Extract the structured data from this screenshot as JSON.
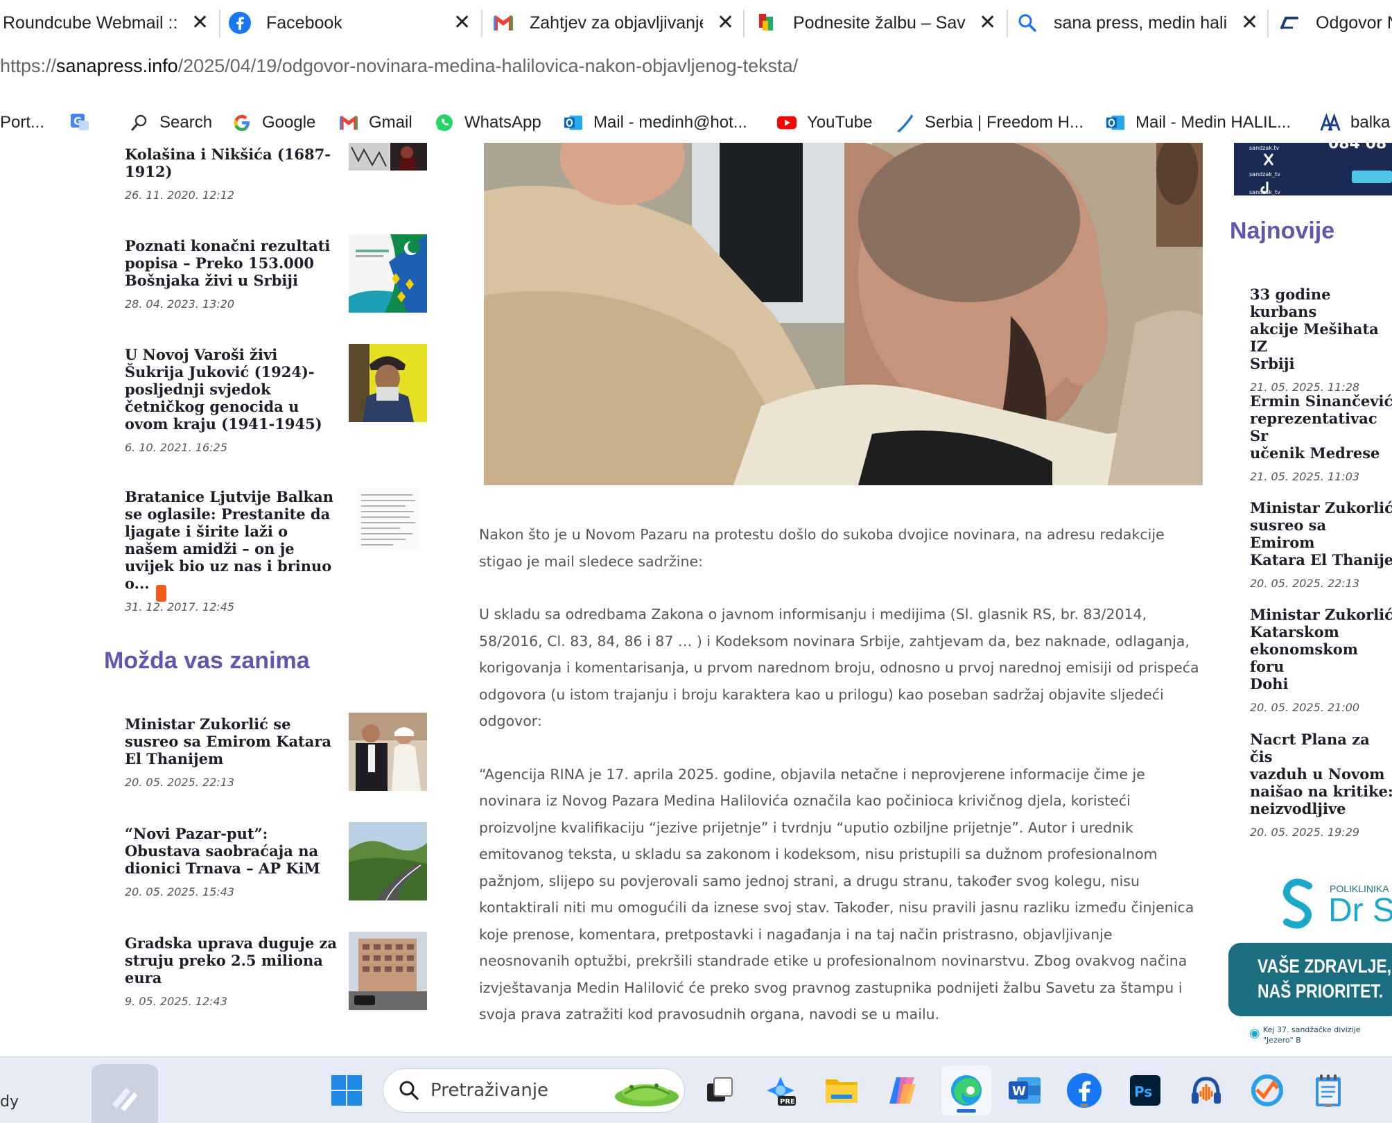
{
  "browser": {
    "tabs": [
      {
        "title": "Roundcube Webmail :: I",
        "icon": "roundcube-icon"
      },
      {
        "title": "Facebook",
        "icon": "facebook-icon"
      },
      {
        "title": "Zahtjev za objavljivanje",
        "icon": "gmail-icon"
      },
      {
        "title": "Podnesite žalbu – Savet",
        "icon": "savet-icon"
      },
      {
        "title": "sana press, medin halilo",
        "icon": "search-icon"
      },
      {
        "title": "Odgovor N",
        "icon": "sanapress-icon"
      }
    ],
    "url": {
      "prefix": "https://",
      "host": "sanapress.info",
      "path": "/2025/04/19/odgovor-novinara-medina-halilovica-nakon-objavljenog-teksta/"
    },
    "bookmarks": [
      {
        "label": "Port...",
        "icon": ""
      },
      {
        "label": "",
        "icon": "translate-icon"
      },
      {
        "label": "Search",
        "icon": "search-icon"
      },
      {
        "label": "Google",
        "icon": "google-icon"
      },
      {
        "label": "Gmail",
        "icon": "gmail-icon"
      },
      {
        "label": "WhatsApp",
        "icon": "whatsapp-icon"
      },
      {
        "label": "Mail - medinh@hot...",
        "icon": "outlook-icon"
      },
      {
        "label": "YouTube",
        "icon": "youtube-icon"
      },
      {
        "label": "Serbia | Freedom H...",
        "icon": "freedom-house-icon"
      },
      {
        "label": "Mail - Medin HALIL...",
        "icon": "outlook-icon"
      },
      {
        "label": "balka",
        "icon": "aa-icon"
      }
    ]
  },
  "left_sidebar": {
    "top_items": [
      {
        "title": "Kolašina i Nikšića (1687-1912)",
        "date": "26. 11. 2020. 12:12"
      },
      {
        "title": "Poznati konačni rezultati popisa – Preko 153.000 Bošnjaka živi u Srbiji",
        "date": "28. 04. 2023. 13:20"
      },
      {
        "title": "U Novoj Varoši živi Šukrija Juković (1924)- posljednji svjedok četničkog genocida u ovom kraju (1941-1945)",
        "date": "6. 10. 2021. 16:25"
      },
      {
        "title": "Bratanice Ljutvije Balkan se oglasile: Prestanite da ljagate i širite laži o našem amidži – on je uvijek bio uz nas i brinuo o...",
        "date": "31. 12. 2017. 12:45"
      }
    ],
    "heading": "Možda vas zanima",
    "more_items": [
      {
        "title": "Ministar Zukorlić se susreo sa Emirom Katara El Thanijem",
        "date": "20. 05. 2025. 22:13"
      },
      {
        "title": "“Novi Pazar-put”: Obustava saobraćaja na dionici Trnava – AP KiM",
        "date": "20. 05. 2025. 15:43"
      },
      {
        "title": "Gradska uprava duguje za struju preko 2.5 miliona eura",
        "date": "9. 05. 2025. 12:43"
      }
    ]
  },
  "article": {
    "paragraphs": [
      "Nakon što je u Novom Pazaru na protestu došlo do sukoba dvojice novinara, na adresu redakcije stigao je mail sledece sadržine:",
      "U skladu sa odredbama Zakona o javnom informisanju i medijima (Sl. glasnik RS, br. 83/2014, 58/2016, Cl. 83, 84, 86 i 87 … ) i Kodeksom novinara Srbije, zahtjevam da, bez naknade, odlaganja, korigovanja i komentarisanja, u prvom narednom broju, odnosno u prvoj narednoj emisiji od prispeća odgovora (u istom trajanju i broju karaktera kao u prilogu) kao poseban sadržaj objavite sljedeći odgovor:",
      "“Agencija RINA je 17. aprila 2025. godine, objavila netačne i neprovjerene informacije čime je novinara iz Novog Pazara Medina Halilovića označila kao počinioca krivičnog djela, koristeći proizvoljne kvalifikaciju “jezive prijetnje” i tvrdnju “uputio ozbiljne prijetnje”. Autor i urednik emitovanog teksta, u skladu sa zakonom i kodeksom, nisu pristupili sa dužnom profesionalnom pažnjom, slijepo su povjerovali samo jednoj strani, a drugu stranu, također svog kolegu, nisu kontaktirali niti mu omogućili da iznese svoj stav. Također, nisu pravili jasnu razliku između činjenica koje prenose, komentara, pretpostavki i nagađanja i na taj način pristrasno, objavljivanje neosnovanih optužbi, prekršili standrade etike u profesionalnom novinarstvu. Zbog ovakvog načina izvještavanja Medin Halilović će preko svog pravnog zastupnika podnijeti žalbu Savetu za štampu i svoja prava zatražiti kod pravosudnih organa, navodi se u mailu."
    ]
  },
  "right_sidebar": {
    "social_banner": {
      "x_handle": "sandzak_tv",
      "top_handle": "sandzak.tv",
      "tiktok_handle": "sandzak_tv",
      "numbers": "084 08"
    },
    "heading": "Najnovije",
    "items": [
      {
        "title_lines": [
          "33 godine kurbans",
          "akcije Mešihata IZ",
          "Srbiji"
        ],
        "date": "21. 05. 2025. 11:28"
      },
      {
        "title_lines": [
          "Ermin Sinančević",
          "reprezentativac Sr",
          "učenik Medrese"
        ],
        "date": "21. 05. 2025. 11:03"
      },
      {
        "title_lines": [
          "Ministar Zukorlić",
          "susreo sa Emirom",
          "Katara El Thanije"
        ],
        "date": "20. 05. 2025. 22:13"
      },
      {
        "title_lines": [
          "Ministar Zukorlić",
          "Katarskom",
          "ekonomskom foru",
          "Dohi"
        ],
        "date": "20. 05. 2025. 21:00"
      },
      {
        "title_lines": [
          "Nacrt Plana za čis",
          "vazduh u Novom",
          "naišao na kritike:",
          "neizvodljive"
        ],
        "date": "20. 05. 2025. 19:29"
      }
    ],
    "clinic_ad": {
      "small_label": "POLIKLINIKA I",
      "brand": "Dr S",
      "slogan_line1": "VAŠE ZDRAVLJE,",
      "slogan_line2": "NAŠ PRIORITET.",
      "address_line1": "Kej 37. sandžačke divizije",
      "address_line2": "\"Jezero\" B"
    }
  },
  "taskbar": {
    "left_text": "dy",
    "search_placeholder": "Pretraživanje",
    "icons": [
      "widgets-icon",
      "windows-start-icon",
      "task-view-icon",
      "copilot-pre-icon",
      "file-explorer-icon",
      "copilot-icon",
      "edge-icon",
      "word-icon",
      "facebook-icon",
      "photoshop-icon",
      "audacity-icon",
      "vpn-icon",
      "notepad-icon"
    ]
  },
  "colors": {
    "heading_purple": "#6454ae",
    "link_dark": "#1e1e2a",
    "clinic_teal": "#1a6e80",
    "clinic_cyan": "#1aa9c8"
  }
}
